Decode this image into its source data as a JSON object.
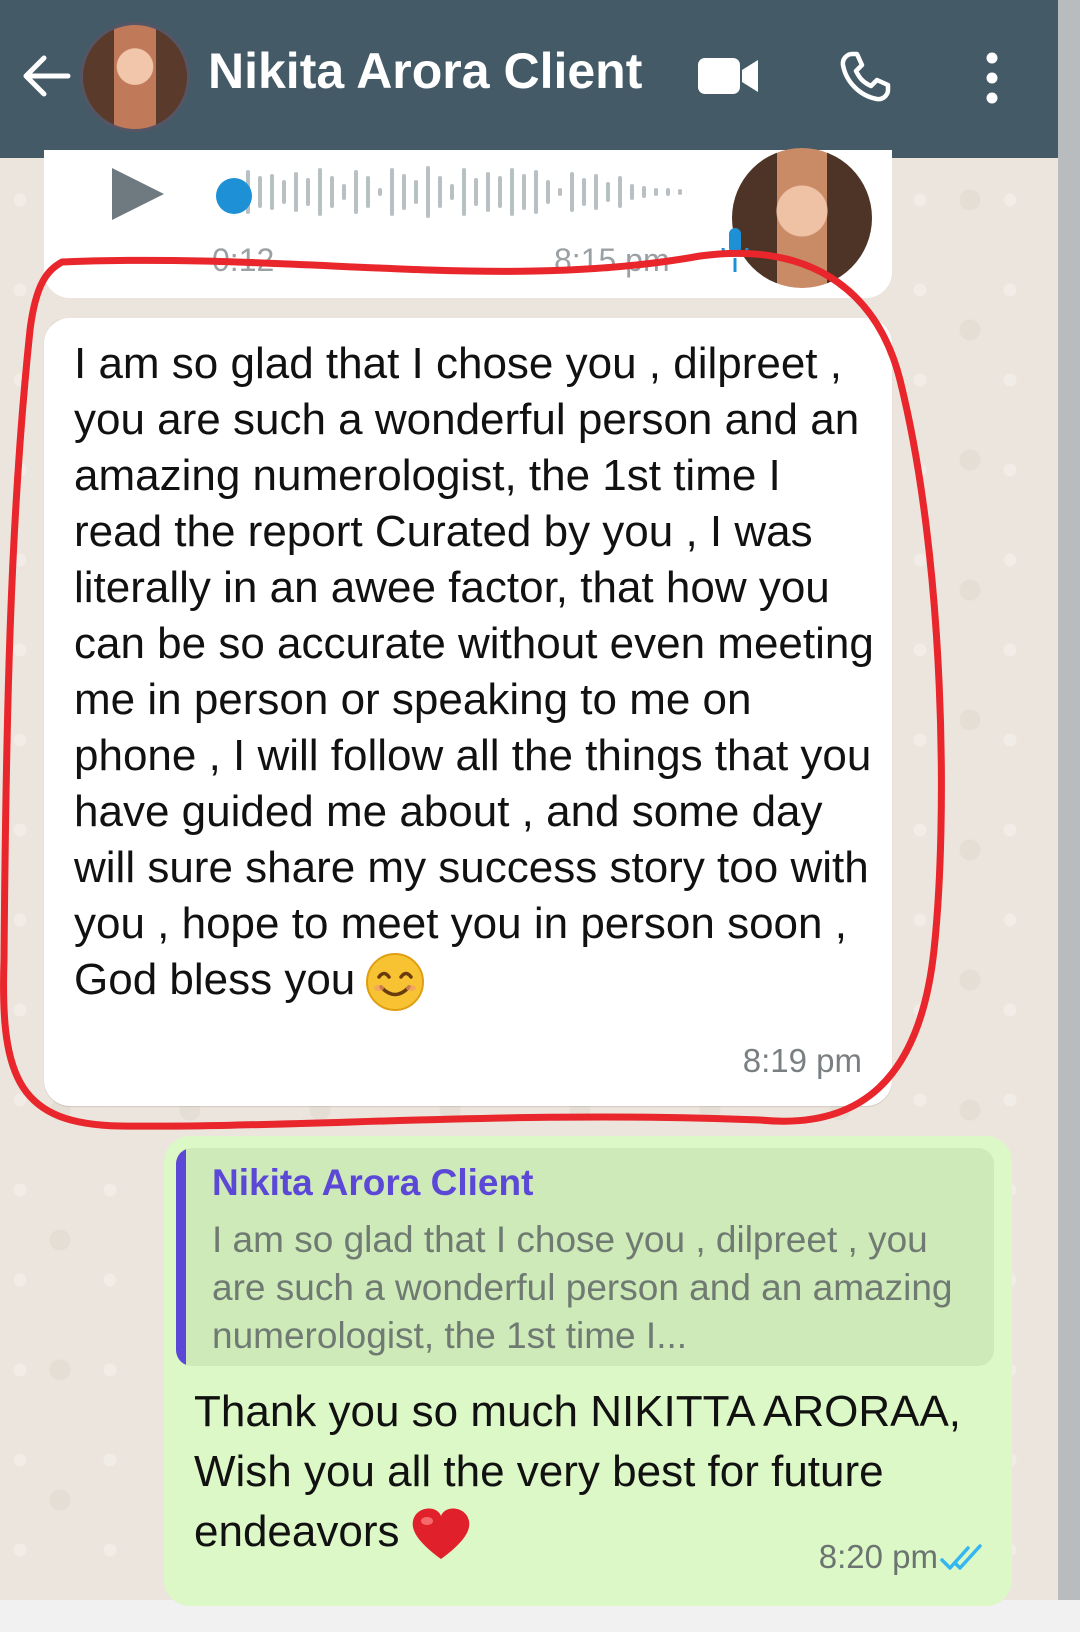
{
  "header": {
    "contact_name": "Nikita Arora Client",
    "icons": [
      "back-arrow-icon",
      "video-call-icon",
      "phone-icon",
      "more-options-icon"
    ]
  },
  "voice_message": {
    "duration": "0:12",
    "time": "8:15 pm"
  },
  "incoming_message": {
    "text": "I am so glad that I chose you , dilpreet , you are such a wonderful person and an amazing numerologist, the 1st time I read the report Curated by you , I was literally  in an awee factor,  that how you can be so accurate without even meeting me in person or speaking to me on phone , I will follow all the things that you have guided me about  , and some day will sure share my success story too with you , hope to meet you in person soon , God bless you",
    "time": "8:19 pm",
    "highlight_color": "#e8262b"
  },
  "outgoing_message": {
    "quote_name": "Nikita Arora Client",
    "quote_text": "I am so glad that I chose you , dilpreet , you are such a wonderful person and an amazing numerologist,  the 1st time I...",
    "text": "Thank you so much NIKITTA ARORAA, Wish you all the very best for future endeavors",
    "time": "8:20 pm"
  },
  "colors": {
    "header": "#445a66",
    "outgoing_bubble": "#dcf8c6",
    "quote_accent": "#5c48d6",
    "read_ticks": "#34b7f1"
  }
}
